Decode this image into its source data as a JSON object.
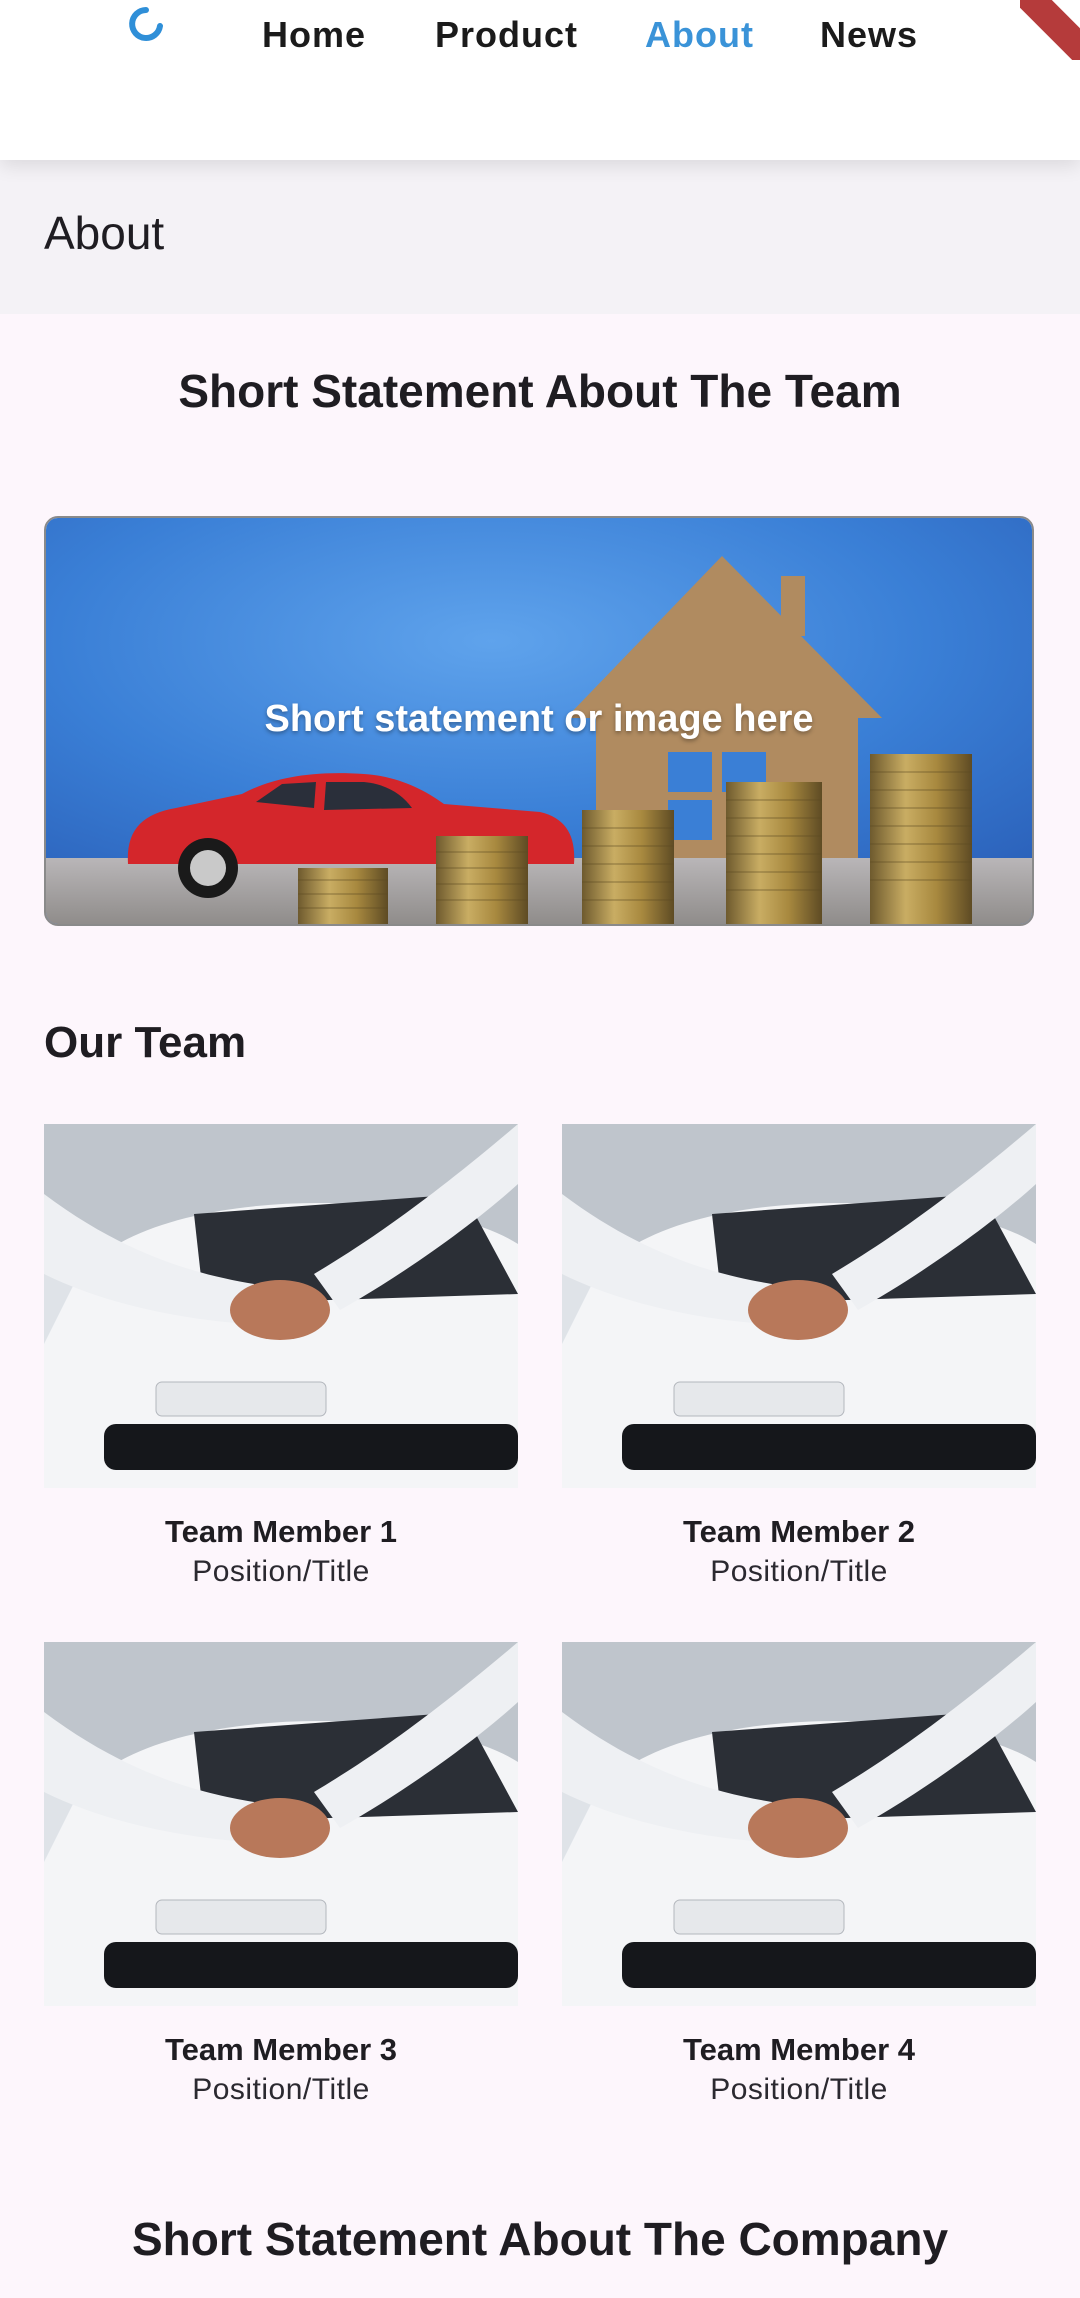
{
  "nav": {
    "logo_icon": "logo-icon",
    "items": [
      {
        "label": "Home",
        "active": false
      },
      {
        "label": "Product",
        "active": false
      },
      {
        "label": "About",
        "active": true
      },
      {
        "label": "News",
        "active": false
      }
    ],
    "accent_color": "#3a93d8"
  },
  "page": {
    "title": "About"
  },
  "team_statement": {
    "heading": "Short Statement About The Team",
    "hero_text": "Short statement or image here"
  },
  "team": {
    "heading": "Our Team",
    "members": [
      {
        "name": "Team Member 1",
        "position": "Position/Title"
      },
      {
        "name": "Team Member 2",
        "position": "Position/Title"
      },
      {
        "name": "Team Member 3",
        "position": "Position/Title"
      },
      {
        "name": "Team Member 4",
        "position": "Position/Title"
      }
    ]
  },
  "company_statement": {
    "heading": "Short Statement About The Company"
  }
}
